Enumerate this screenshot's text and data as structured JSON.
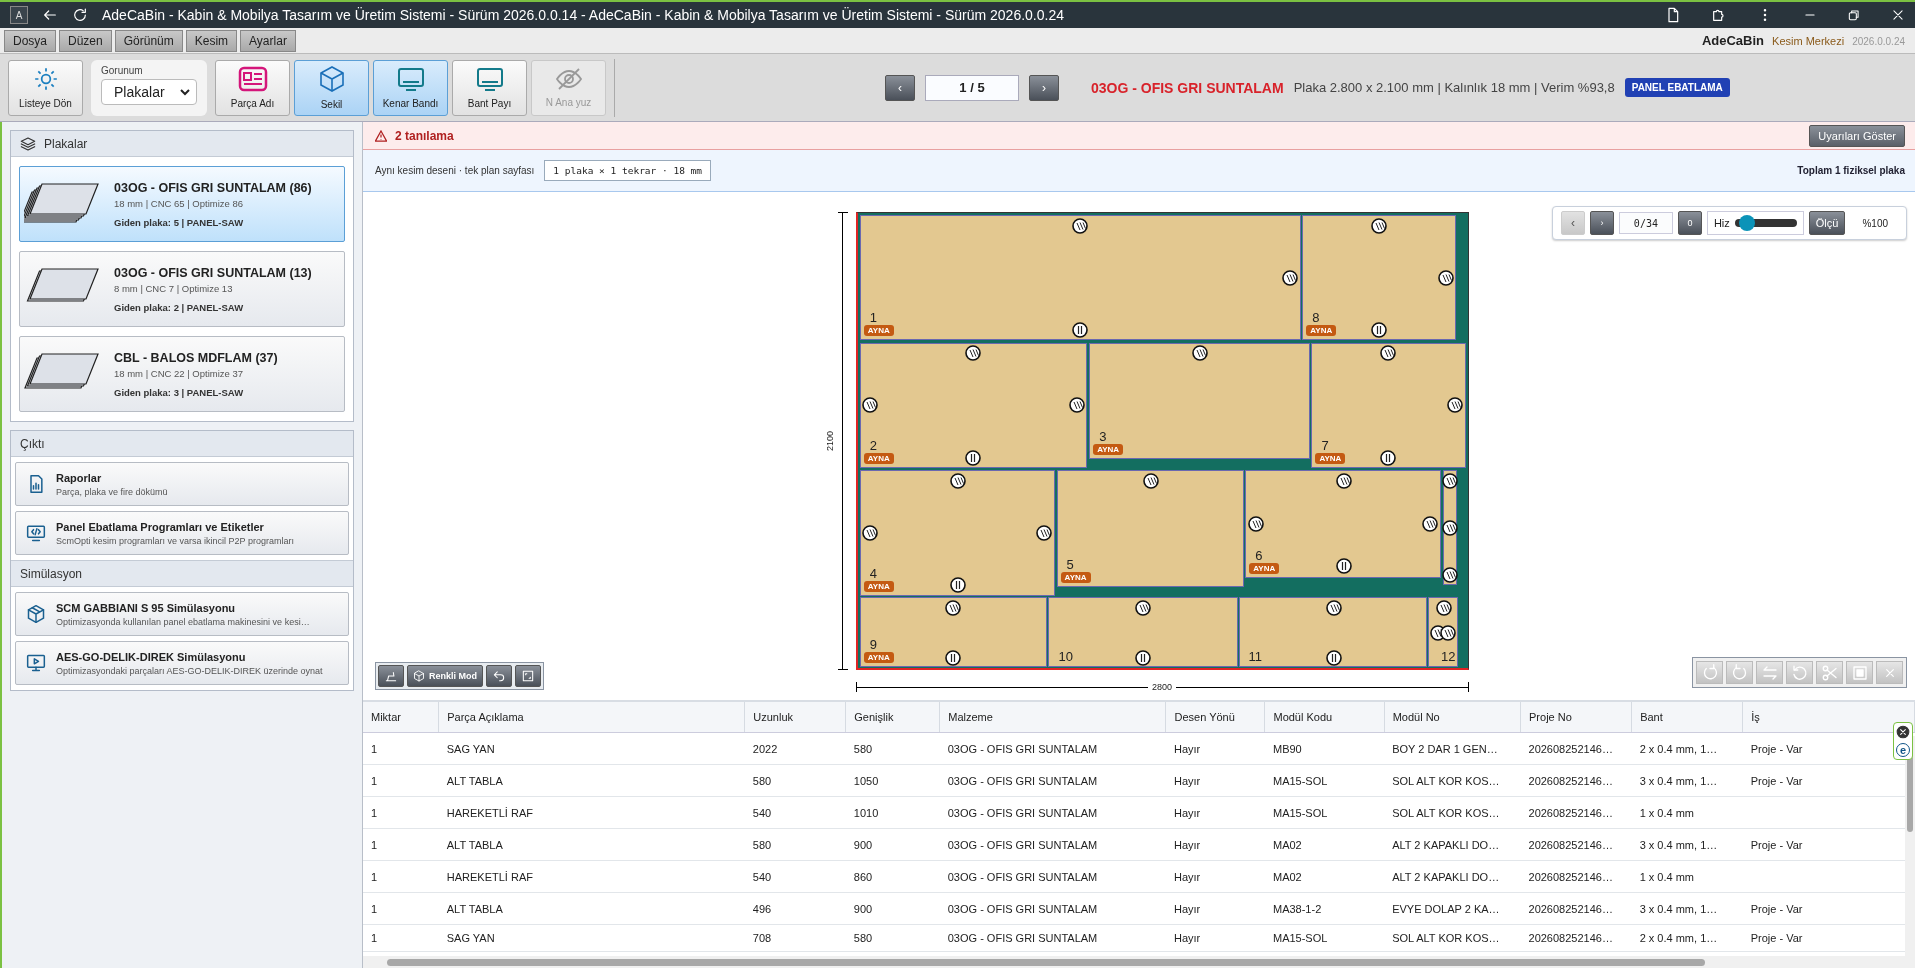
{
  "window": {
    "app_icon": "A",
    "title": "AdeCaBin - Kabin & Mobilya Tasarım ve Üretim Sistemi - Sürüm 2026.0.0.14 - AdeCaBin - Kabin & Mobilya Tasarım ve Üretim Sistemi - Sürüm 2026.0.0.24"
  },
  "menu": [
    {
      "label": "Dosya"
    },
    {
      "label": "Düzen"
    },
    {
      "label": "Görünüm"
    },
    {
      "label": "Kesim"
    },
    {
      "label": "Ayarlar"
    }
  ],
  "brand": {
    "name": "AdeCaBin",
    "subtitle": "Kesim Merkezi",
    "version": "2026.0.0.24"
  },
  "toolbar": {
    "back": "Listeye Dön",
    "view": {
      "label": "Gorunum",
      "value": "Plakalar"
    },
    "buttons": [
      {
        "label": "Parça Adı",
        "selected": false,
        "disabled": false
      },
      {
        "label": "Sekil",
        "selected": true,
        "disabled": false
      },
      {
        "label": "Kenar Bandı",
        "selected": true,
        "disabled": false
      },
      {
        "label": "Bant Payı",
        "selected": false,
        "disabled": false
      },
      {
        "label": "N Ana yuz",
        "selected": false,
        "disabled": true
      }
    ]
  },
  "pager": {
    "prev": "‹",
    "value": "1 / 5",
    "next": "›"
  },
  "sheet": {
    "material": "03OG - OFIS GRI SUNTALAM",
    "details": "Plaka 2.800 x 2.100 mm | Kalınlık 18 mm | Verim %93,8",
    "badge": "PANEL EBATLAMA"
  },
  "plates": {
    "title": "Plakalar",
    "items": [
      {
        "title": "03OG - OFIS GRI SUNTALAM (86)",
        "meta": "18 mm | CNC 65 | Optimize 86",
        "footer": "Giden plaka: 5 | PANEL-SAW",
        "selected": true
      },
      {
        "title": "03OG - OFIS GRI SUNTALAM (13)",
        "meta": "8 mm | CNC 7 | Optimize 13",
        "footer": "Giden plaka: 2 | PANEL-SAW",
        "selected": false
      },
      {
        "title": "CBL - BALOS MDFLAM (37)",
        "meta": "18 mm | CNC 22 | Optimize 37",
        "footer": "Giden plaka: 3 | PANEL-SAW",
        "selected": false
      }
    ]
  },
  "output": {
    "title": "Çıktı",
    "items": [
      {
        "title": "Raporlar",
        "subtitle": "Parça, plaka ve fire dökümü"
      },
      {
        "title": "Panel Ebatlama Programları ve Etiketler",
        "subtitle": "ScmOpti kesim programları ve varsa ikincil P2P programları"
      }
    ]
  },
  "simulation": {
    "title": "Simülasyon",
    "items": [
      {
        "title": "SCM GABBIANI S 95 Simülasyonu",
        "subtitle": "Optimizasyonda kullanılan panel ebatlama makinesini ve kesi…"
      },
      {
        "title": "AES-GO-DELIK-DIREK Simülasyonu",
        "subtitle": "Optimizasyondaki parçaları AES-GO-DELIK-DIREK üzerinde oynat"
      }
    ]
  },
  "warning": {
    "text": "2 tanılama",
    "button": "Uyarıları Göster"
  },
  "plan": {
    "label": "Aynı kesim deseni · tek plan sayfası",
    "code": "1 plaka × 1 tekrar · 18 mm",
    "total": "Toplam 1 fiziksel plaka"
  },
  "sim_controls": {
    "prev": {
      "label": "‹",
      "disabled": true
    },
    "next": {
      "label": "›",
      "disabled": false
    },
    "step": "0/34",
    "reset": "0",
    "speed_label": "Hiz",
    "level": 0.2,
    "measure": "Ölçü",
    "zoom": "%100"
  },
  "board": {
    "height_label": "2100",
    "width_label": "2800",
    "pieces": [
      {
        "number": "1",
        "badge": "AYNA"
      },
      {
        "number": "8",
        "badge": "AYNA"
      },
      {
        "number": "2",
        "badge": "AYNA"
      },
      {
        "number": "3",
        "badge": "AYNA"
      },
      {
        "number": "7",
        "badge": "AYNA"
      },
      {
        "number": "4",
        "badge": "AYNA"
      },
      {
        "number": "5",
        "badge": "AYNA"
      },
      {
        "number": "6",
        "badge": "AYNA"
      },
      {
        "number": "9",
        "badge": "AYNA"
      },
      {
        "number": "10"
      },
      {
        "number": "11"
      },
      {
        "number": "12"
      }
    ]
  },
  "canvas_tools": {
    "color_mode": "Renkli Mod"
  },
  "edit_tools": [
    {
      "disabled": true
    },
    {
      "disabled": true
    },
    {
      "disabled": true
    },
    {
      "disabled": true
    },
    {
      "disabled": true
    },
    {
      "disabled": true
    },
    {
      "disabled": true
    }
  ],
  "side_tab": {
    "letter": "e"
  },
  "table": {
    "columns": [
      "Miktar",
      "Parça Açıklama",
      "Uzunluk",
      "Genişlik",
      "Malzeme",
      "Desen Yönü",
      "Modül Kodu",
      "Modül No",
      "Proje No",
      "Bant",
      "İş"
    ],
    "rows": [
      [
        "1",
        "SAG YAN",
        "2022",
        "580",
        "03OG - OFIS GRI SUNTALAM",
        "Hayır",
        "MB90",
        "BOY 2 DAR 1 GEN…",
        "202608252146…",
        "2 x 0.4 mm, 1…",
        "Proje - Var"
      ],
      [
        "1",
        "ALT TABLA",
        "580",
        "1050",
        "03OG - OFIS GRI SUNTALAM",
        "Hayır",
        "MA15-SOL",
        "SOL ALT KOR KOS…",
        "202608252146…",
        "3 x 0.4 mm, 1…",
        "Proje - Var"
      ],
      [
        "1",
        "HAREKETLİ RAF",
        "540",
        "1010",
        "03OG - OFIS GRI SUNTALAM",
        "Hayır",
        "MA15-SOL",
        "SOL ALT KOR KOS…",
        "202608252146…",
        "1 x 0.4 mm",
        ""
      ],
      [
        "1",
        "ALT TABLA",
        "580",
        "900",
        "03OG - OFIS GRI SUNTALAM",
        "Hayır",
        "MA02",
        "ALT 2 KAPAKLI DO…",
        "202608252146…",
        "3 x 0.4 mm, 1…",
        "Proje - Var"
      ],
      [
        "1",
        "HAREKETLİ RAF",
        "540",
        "860",
        "03OG - OFIS GRI SUNTALAM",
        "Hayır",
        "MA02",
        "ALT 2 KAPAKLI DO…",
        "202608252146…",
        "1 x 0.4 mm",
        ""
      ],
      [
        "1",
        "ALT TABLA",
        "496",
        "900",
        "03OG - OFIS GRI SUNTALAM",
        "Hayır",
        "MA38-1-2",
        "EVYE DOLAP 2 KA…",
        "202608252146…",
        "3 x 0.4 mm, 1…",
        "Proje - Var"
      ],
      [
        "1",
        "SAG YAN",
        "708",
        "580",
        "03OG - OFIS GRI SUNTALAM",
        "Hayır",
        "MA15-SOL",
        "SOL ALT KOR KOS…",
        "202608252146…",
        "2 x 0.4 mm, 1…",
        "Proje - Var"
      ]
    ]
  }
}
